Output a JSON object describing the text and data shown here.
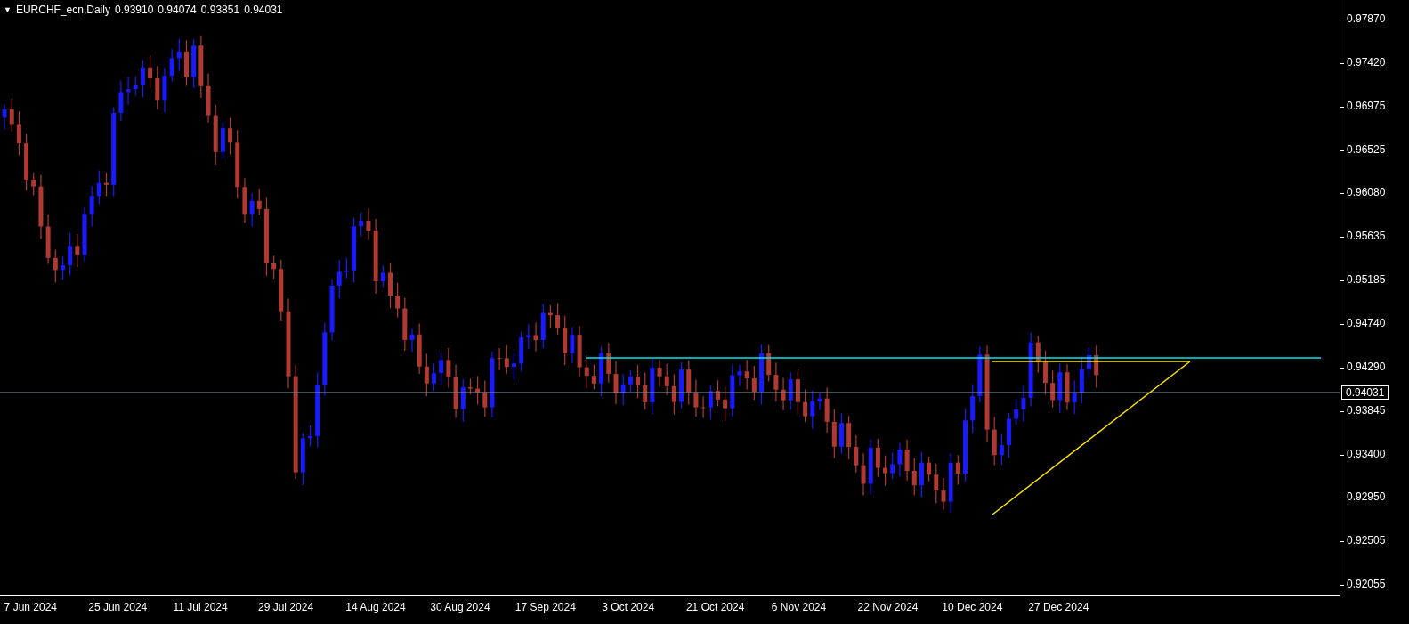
{
  "header": {
    "menu_glyph": "▼",
    "symbol": "EURCHF_ecn,Daily",
    "quotes": [
      "0.93910",
      "0.94074",
      "0.93851",
      "0.94031"
    ]
  },
  "price_axis": [
    "0.97870",
    "0.97420",
    "0.96975",
    "0.96525",
    "0.96080",
    "0.95635",
    "0.95185",
    "0.94740",
    "0.94290",
    "0.93845",
    "0.93400",
    "0.92950",
    "0.92505",
    "0.92055"
  ],
  "current_price": "0.94031",
  "date_axis": [
    "7 Jun 2024",
    "25 Jun 2024",
    "11 Jul 2024",
    "29 Jul 2024",
    "14 Aug 2024",
    "30 Aug 2024",
    "17 Sep 2024",
    "3 Oct 2024",
    "21 Oct 2024",
    "6 Nov 2024",
    "22 Nov 2024",
    "10 Dec 2024",
    "27 Dec 2024"
  ]
}
